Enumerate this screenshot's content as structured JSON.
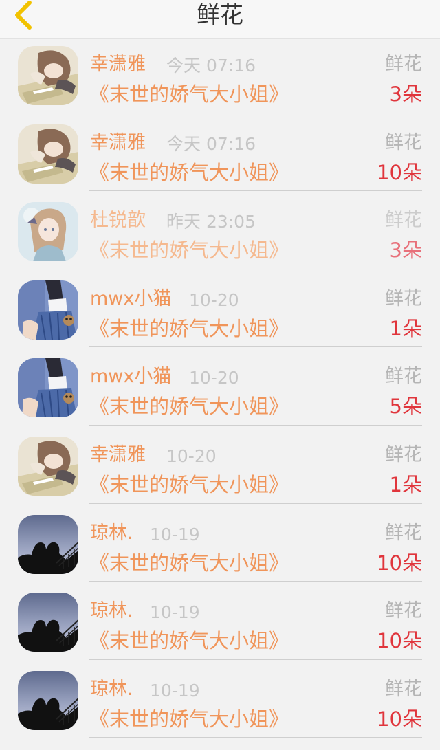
{
  "header": {
    "title": "鲜花"
  },
  "colors": {
    "name": "#f0955a",
    "count": "#e0353c",
    "back_icon": "#f2c200"
  },
  "rows": [
    {
      "name": "幸潇雅",
      "time": "今天 07:16",
      "book": "《末世的娇气大小姐》",
      "label": "鲜花",
      "count": "3朵",
      "avatar": "anime-girl-sleeping-avatar"
    },
    {
      "name": "幸潇雅",
      "time": "今天 07:16",
      "book": "《末世的娇气大小姐》",
      "label": "鲜花",
      "count": "10朵",
      "avatar": "anime-girl-sleeping-avatar"
    },
    {
      "name": "杜锐歆",
      "time": "昨天 23:05",
      "book": "《末世的娇气大小姐》",
      "label": "鲜花",
      "count": "3朵",
      "avatar": "anime-girl-pastel-avatar"
    },
    {
      "name": "mwx小猫",
      "time": "10-20",
      "book": "《末世的娇气大小姐》",
      "label": "鲜花",
      "count": "1朵",
      "avatar": "anime-schoolgirl-avatar"
    },
    {
      "name": "mwx小猫",
      "time": "10-20",
      "book": "《末世的娇气大小姐》",
      "label": "鲜花",
      "count": "5朵",
      "avatar": "anime-schoolgirl-avatar"
    },
    {
      "name": "幸潇雅",
      "time": "10-20",
      "book": "《末世的娇气大小姐》",
      "label": "鲜花",
      "count": "1朵",
      "avatar": "anime-girl-sleeping-avatar"
    },
    {
      "name": "琼林.",
      "time": "10-19",
      "book": "《末世的娇气大小姐》",
      "label": "鲜花",
      "count": "10朵",
      "avatar": "couple-silhouette-avatar"
    },
    {
      "name": "琼林.",
      "time": "10-19",
      "book": "《末世的娇气大小姐》",
      "label": "鲜花",
      "count": "10朵",
      "avatar": "couple-silhouette-avatar"
    },
    {
      "name": "琼林.",
      "time": "10-19",
      "book": "《末世的娇气大小姐》",
      "label": "鲜花",
      "count": "10朵",
      "avatar": "couple-silhouette-avatar"
    }
  ]
}
